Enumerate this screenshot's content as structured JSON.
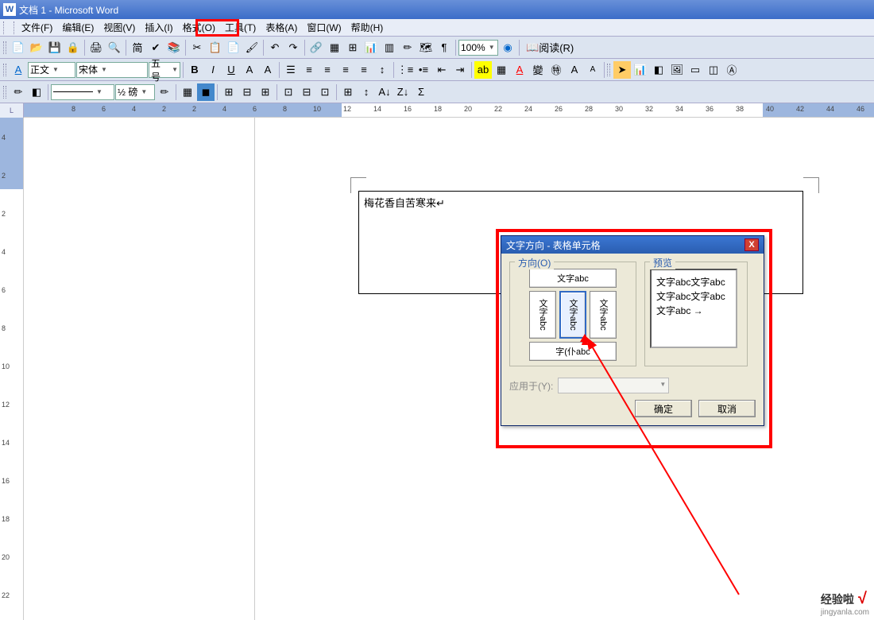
{
  "title": "文档 1 - Microsoft Word",
  "menus": {
    "file": "文件(F)",
    "edit": "编辑(E)",
    "view": "视图(V)",
    "insert": "插入(I)",
    "format": "格式(O)",
    "tools": "工具(T)",
    "table": "表格(A)",
    "window": "窗口(W)",
    "help": "帮助(H)"
  },
  "toolbar1": {
    "zoom": "100%"
  },
  "toolbar2": {
    "style_label": "正文",
    "font_label": "宋体",
    "size_label": "五号"
  },
  "toolbar3": {
    "line_weight": "½ 磅"
  },
  "read_mode": "阅读(R)",
  "ruler": {
    "h": [
      "8",
      "6",
      "4",
      "2",
      "2",
      "4",
      "6",
      "8",
      "10",
      "12",
      "14",
      "16",
      "18",
      "20",
      "22",
      "24",
      "26",
      "28",
      "30",
      "32",
      "34",
      "36",
      "38",
      "40",
      "42",
      "44",
      "46"
    ],
    "v": [
      "4",
      "2",
      "2",
      "4",
      "6",
      "8",
      "10",
      "12",
      "14",
      "16",
      "18",
      "20",
      "22"
    ]
  },
  "doc": {
    "cell_text": "梅花香自苦寒来"
  },
  "dialog": {
    "title": "文字方向 - 表格单元格",
    "orientation_label": "方向(O)",
    "preview_label": "预览",
    "sample_h": "文字abc",
    "sample_v1": "文字abc",
    "sample_v2": "文字abc",
    "sample_v3": "文字abc",
    "sample_h2": "字(仆abc",
    "preview_text": "文字abc文字abc文字abc文字abc文字abc →",
    "apply_label": "应用于(Y):",
    "ok": "确定",
    "cancel": "取消"
  },
  "watermark": {
    "brand": "经验啦",
    "site": "jingyanla.com"
  }
}
